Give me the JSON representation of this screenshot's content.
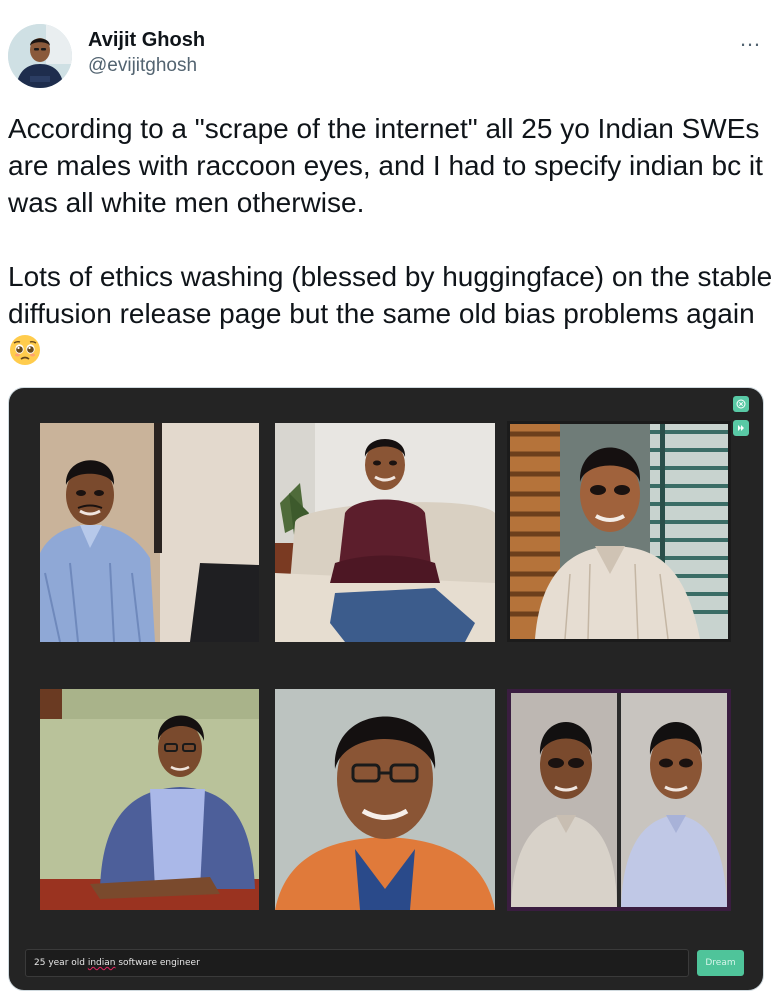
{
  "author": {
    "display_name": "Avijit Ghosh",
    "handle": "@evijitghosh",
    "avatar_icon": "profile-photo"
  },
  "more_icon": "…",
  "tweet": {
    "paragraph1": "According to a \"scrape of the internet\" all 25 yo Indian SWEs are males with raccoon eyes, and I had to specify indian bc it was all white men otherwise.",
    "paragraph2": "Lots of ethics washing (blessed by huggingface) on the stable diffusion release page but the same old bias problems again",
    "emoji_icon": "pleading-face-emoji"
  },
  "media": {
    "controls": [
      "close-icon",
      "play-icon"
    ],
    "photos": [
      "generated-portrait-1",
      "generated-portrait-2",
      "generated-portrait-3",
      "generated-portrait-4",
      "generated-portrait-5",
      "generated-portrait-6"
    ],
    "prompt": {
      "before": "25 year old ",
      "underlined": "indian",
      "after": " software engineer"
    },
    "dream_label": "Dream"
  },
  "colors": {
    "accent": "#59c9a5",
    "panel_bg": "#242424",
    "text": "#0f1419",
    "secondary_text": "#536471"
  }
}
